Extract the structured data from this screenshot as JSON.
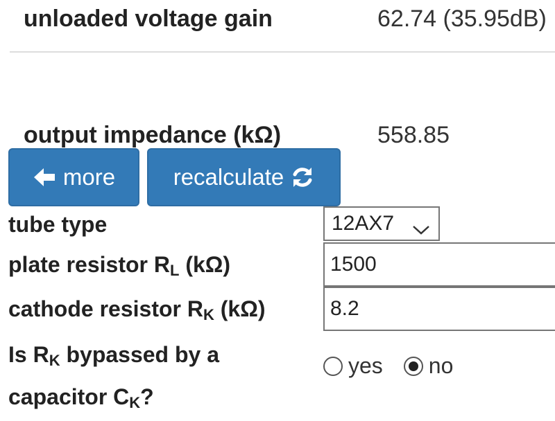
{
  "results": {
    "gain_label": "unloaded voltage gain",
    "gain_value": "62.74 (35.95dB)",
    "impedance_label": "output impedance (kΩ)",
    "impedance_value": "558.85"
  },
  "buttons": {
    "more_label": "more",
    "recalculate_label": "recalculate"
  },
  "form": {
    "tube_type_label": "tube type",
    "tube_type_value": "12AX7",
    "plate_label_prefix": "plate resistor R",
    "plate_label_sub": "L",
    "plate_label_suffix": " (kΩ)",
    "plate_value": "1500",
    "cathode_label_prefix": "cathode resistor R",
    "cathode_label_sub": "K",
    "cathode_label_suffix": " (kΩ)",
    "cathode_value": "8.2",
    "bypass_label_1": "Is R",
    "bypass_label_1_sub": "K",
    "bypass_label_1_suffix": " bypassed by a",
    "bypass_label_2": "capacitor C",
    "bypass_label_2_sub": "K",
    "bypass_label_2_suffix": "?",
    "radio_yes": "yes",
    "radio_no": "no",
    "selected": "no"
  },
  "icons": {
    "more": "arrow-left-icon",
    "recalculate": "refresh-icon",
    "select": "chevron-down-icon"
  },
  "colors": {
    "button_bg": "#337ab7",
    "button_border": "#2e6da4"
  }
}
